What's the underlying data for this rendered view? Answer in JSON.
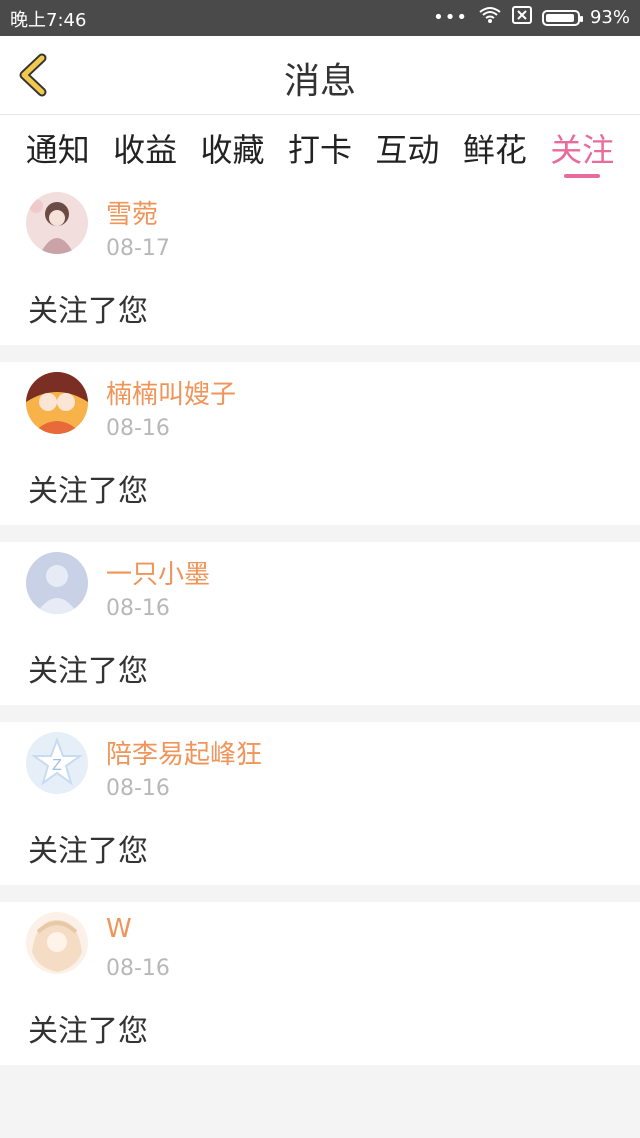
{
  "status_bar": {
    "time": "晚上7:46",
    "battery": "93%",
    "icons": [
      "more-dots-icon",
      "wifi-icon",
      "sim-icon",
      "battery-icon"
    ]
  },
  "header": {
    "title": "消息",
    "back_icon": "chevron-left-icon"
  },
  "tabs": [
    {
      "label": "通知"
    },
    {
      "label": "收益"
    },
    {
      "label": "收藏"
    },
    {
      "label": "打卡"
    },
    {
      "label": "互动"
    },
    {
      "label": "鲜花"
    },
    {
      "label": "关注",
      "active": true
    }
  ],
  "messages": [
    {
      "name": "雪菀",
      "date": "08-17",
      "text": "关注了您"
    },
    {
      "name": "楠楠叫嫂子",
      "date": "08-16",
      "text": "关注了您"
    },
    {
      "name": "一只小墨",
      "date": "08-16",
      "text": "关注了您"
    },
    {
      "name": "陪李易起峰狂",
      "date": "08-16",
      "text": "关注了您"
    },
    {
      "name": "W",
      "date": "08-16",
      "text": "关注了您"
    }
  ],
  "colors": {
    "accent": "#e96b9b",
    "username": "#f0955a",
    "back_arrow": "#f2c94c"
  }
}
